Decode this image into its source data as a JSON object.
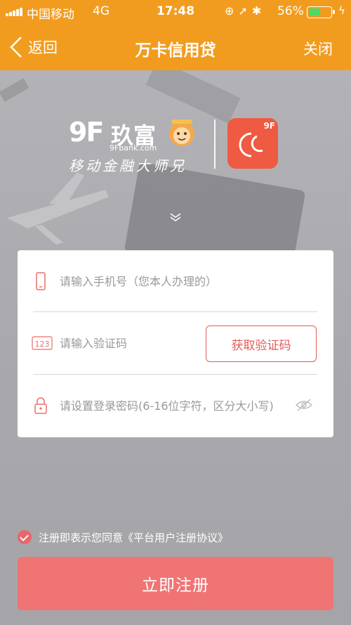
{
  "status_bar": {
    "carrier": "中国移动",
    "network": "4G",
    "time": "17:48",
    "battery_percent": "56%",
    "battery_level": 0.56,
    "icons": [
      "lock-rotation-icon",
      "location-icon",
      "bluetooth-icon",
      "charging-icon"
    ]
  },
  "nav": {
    "back_label": "返回",
    "title": "万卡信用贷",
    "close_label": "关闭"
  },
  "logo": {
    "mark": "9F",
    "brand": "玖富",
    "domain": "9Fbank.com",
    "slogan": "移动金融大师兄",
    "app_badge": "9F"
  },
  "form": {
    "phone_placeholder": "请输入手机号（您本人办理的）",
    "phone_value": "",
    "code_placeholder": "请输入验证码",
    "code_value": "",
    "code_button": "获取验证码",
    "password_placeholder": "请设置登录密码(6-16位字符，区分大小写)",
    "password_value": ""
  },
  "agreement": {
    "prefix": "注册即表示您同意",
    "link": "《平台用户注册协议》",
    "checked": true
  },
  "submit_label": "立即注册",
  "colors": {
    "nav_bg": "#f29c1f",
    "accent": "#e35b58",
    "submit_bg": "#f07474",
    "page_bg": "#a7a7ab"
  }
}
